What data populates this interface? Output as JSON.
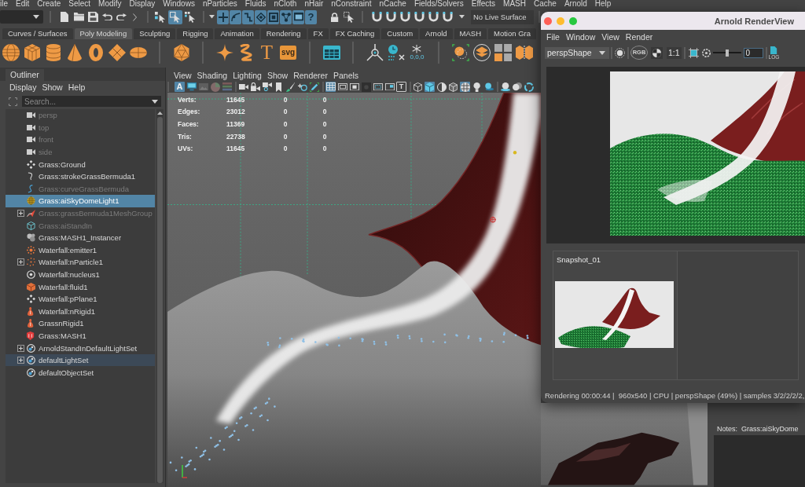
{
  "menu_bar": {
    "items": [
      "ile",
      "Edit",
      "Create",
      "Select",
      "Modify",
      "Display",
      "Windows",
      "nParticles",
      "Fluids",
      "nCloth",
      "nHair",
      "nConstraint",
      "nCache",
      "Fields/Solvers",
      "Effects",
      "MASH",
      "Cache",
      "Arnold",
      "Help"
    ]
  },
  "status_line": {
    "select_modes": [
      {
        "selected": false
      },
      {
        "selected": true
      },
      {
        "selected": false
      }
    ],
    "snaps": [
      {
        "on": true
      },
      {
        "on": true
      },
      {
        "on": true
      },
      {
        "on": true
      },
      {
        "on": true
      },
      {
        "on": true
      },
      {
        "on": true
      },
      {
        "on": true,
        "label": "?"
      }
    ],
    "live_surface": "No Live Surface"
  },
  "shelf_tabs": [
    {
      "label": "Curves / Surfaces",
      "selected": false
    },
    {
      "label": "Poly Modeling",
      "selected": true
    },
    {
      "label": "Sculpting",
      "selected": false
    },
    {
      "label": "Rigging",
      "selected": false
    },
    {
      "label": "Animation",
      "selected": false
    },
    {
      "label": "Rendering",
      "selected": false
    },
    {
      "label": "FX",
      "selected": false
    },
    {
      "label": "FX Caching",
      "selected": false
    },
    {
      "label": "Custom",
      "selected": false
    },
    {
      "label": "Arnold",
      "selected": false
    },
    {
      "label": "MASH",
      "selected": false
    },
    {
      "label": "Motion Gra",
      "selected": false
    }
  ],
  "shelf": {
    "text_tool": "T",
    "svg_tool": "svg",
    "origin_label": "0,0,0"
  },
  "outliner": {
    "tab": "Outliner",
    "menu": [
      "Display",
      "Show",
      "Help"
    ],
    "search": {
      "placeholder": "Search..."
    },
    "items": [
      {
        "label": "persp",
        "kind": "camera",
        "dimmed": true,
        "selected": false,
        "highlighted": false,
        "expandable": false
      },
      {
        "label": "top",
        "kind": "camera",
        "dimmed": true,
        "selected": false,
        "highlighted": false,
        "expandable": false
      },
      {
        "label": "front",
        "kind": "camera",
        "dimmed": true,
        "selected": false,
        "highlighted": false,
        "expandable": false
      },
      {
        "label": "side",
        "kind": "camera",
        "dimmed": true,
        "selected": false,
        "highlighted": false,
        "expandable": false
      },
      {
        "label": "Grass:Ground",
        "kind": "mesh",
        "dimmed": false,
        "selected": false,
        "highlighted": false,
        "expandable": false
      },
      {
        "label": "Grass:strokeGrassBermuda1",
        "kind": "stroke",
        "dimmed": false,
        "selected": false,
        "highlighted": false,
        "expandable": false
      },
      {
        "label": "Grass:curveGrassBermuda",
        "kind": "curve",
        "dimmed": true,
        "selected": false,
        "highlighted": false,
        "expandable": false
      },
      {
        "label": "Grass:aiSkyDomeLight1",
        "kind": "light",
        "dimmed": false,
        "selected": true,
        "highlighted": false,
        "expandable": false
      },
      {
        "label": "Grass:grassBermuda1MeshGroup",
        "kind": "group",
        "dimmed": true,
        "selected": false,
        "highlighted": false,
        "expandable": true
      },
      {
        "label": "Grass:aiStandIn",
        "kind": "standin",
        "dimmed": true,
        "selected": false,
        "highlighted": false,
        "expandable": false
      },
      {
        "label": "Grass:MASH1_Instancer",
        "kind": "instancer",
        "dimmed": false,
        "selected": false,
        "highlighted": false,
        "expandable": false
      },
      {
        "label": "Waterfall:emitter1",
        "kind": "emitter",
        "dimmed": false,
        "selected": false,
        "highlighted": false,
        "expandable": false
      },
      {
        "label": "Waterfall:nParticle1",
        "kind": "particles",
        "dimmed": false,
        "selected": false,
        "highlighted": false,
        "expandable": true
      },
      {
        "label": "Waterfall:nucleus1",
        "kind": "nucleus",
        "dimmed": false,
        "selected": false,
        "highlighted": false,
        "expandable": false
      },
      {
        "label": "Waterfall:fluid1",
        "kind": "fluid",
        "dimmed": false,
        "selected": false,
        "highlighted": false,
        "expandable": false
      },
      {
        "label": "Waterfall:pPlane1",
        "kind": "mesh",
        "dimmed": false,
        "selected": false,
        "highlighted": false,
        "expandable": false
      },
      {
        "label": "Waterfall:nRigid1",
        "kind": "rigid",
        "dimmed": false,
        "selected": false,
        "highlighted": false,
        "expandable": false
      },
      {
        "label": "GrassnRigid1",
        "kind": "rigid",
        "dimmed": false,
        "selected": false,
        "highlighted": false,
        "expandable": false
      },
      {
        "label": "Grass:MASH1",
        "kind": "mash",
        "dimmed": false,
        "selected": false,
        "highlighted": false,
        "expandable": false
      },
      {
        "label": "ArnoldStandInDefaultLightSet",
        "kind": "set",
        "dimmed": false,
        "selected": false,
        "highlighted": false,
        "expandable": true
      },
      {
        "label": "defaultLightSet",
        "kind": "set",
        "dimmed": false,
        "selected": false,
        "highlighted": true,
        "expandable": true
      },
      {
        "label": "defaultObjectSet",
        "kind": "set",
        "dimmed": false,
        "selected": false,
        "highlighted": false,
        "expandable": false
      }
    ]
  },
  "viewport": {
    "menu": [
      "View",
      "Shading",
      "Lighting",
      "Show",
      "Renderer",
      "Panels"
    ],
    "toolbar": [
      {
        "buttons": [
          {
            "on": true,
            "label": "A"
          },
          {
            "on": false
          },
          {
            "on": false
          },
          {
            "on": false
          },
          {
            "on": false
          }
        ]
      },
      {
        "buttons": [
          {
            "on": false
          },
          {
            "on": false
          },
          {
            "on": false
          },
          {
            "on": false
          },
          {
            "on": false
          },
          {
            "on": false
          },
          {
            "on": false
          }
        ]
      },
      {
        "buttons": [
          {
            "on": true
          },
          {
            "on": false
          },
          {
            "on": false
          },
          {
            "on": false
          },
          {
            "on": false
          },
          {
            "on": false
          },
          {
            "on": false,
            "label": "T"
          }
        ]
      },
      {
        "buttons": [
          {
            "on": false
          },
          {
            "on": true
          },
          {
            "on": false
          },
          {
            "on": false
          },
          {
            "on": true
          },
          {
            "on": false
          },
          {
            "on": false
          }
        ]
      },
      {
        "buttons": [
          {
            "on": false
          },
          {
            "on": false
          },
          {
            "on": false
          }
        ]
      }
    ],
    "hud": {
      "rows": [
        {
          "label": "Verts:",
          "values": [
            "11645",
            "0",
            "0"
          ]
        },
        {
          "label": "Edges:",
          "values": [
            "23012",
            "0",
            "0"
          ]
        },
        {
          "label": "Faces:",
          "values": [
            "11369",
            "0",
            "0"
          ]
        },
        {
          "label": "Tris:",
          "values": [
            "22738",
            "0",
            "0"
          ]
        },
        {
          "label": "UVs:",
          "values": [
            "11645",
            "0",
            "0"
          ]
        }
      ]
    }
  },
  "attribute_editor": {
    "notes_label": "Notes:",
    "notes_node": "Grass:aiSkyDome"
  },
  "render_view": {
    "title": "Arnold RenderView",
    "menu": [
      "File",
      "Window",
      "View",
      "Render"
    ],
    "camera": "perspShape",
    "rgb_label": "RGB",
    "zoom_ratio": "1:1",
    "exposure": {
      "level": 0.5
    },
    "exposure_value": "0",
    "log_label": "LOG",
    "snapshots": [
      {
        "label": "Snapshot_01"
      }
    ],
    "status": "Rendering 00:00:44 |  960x540 | CPU | perspShape (49%) | samples 3/2/2/2/2,"
  }
}
